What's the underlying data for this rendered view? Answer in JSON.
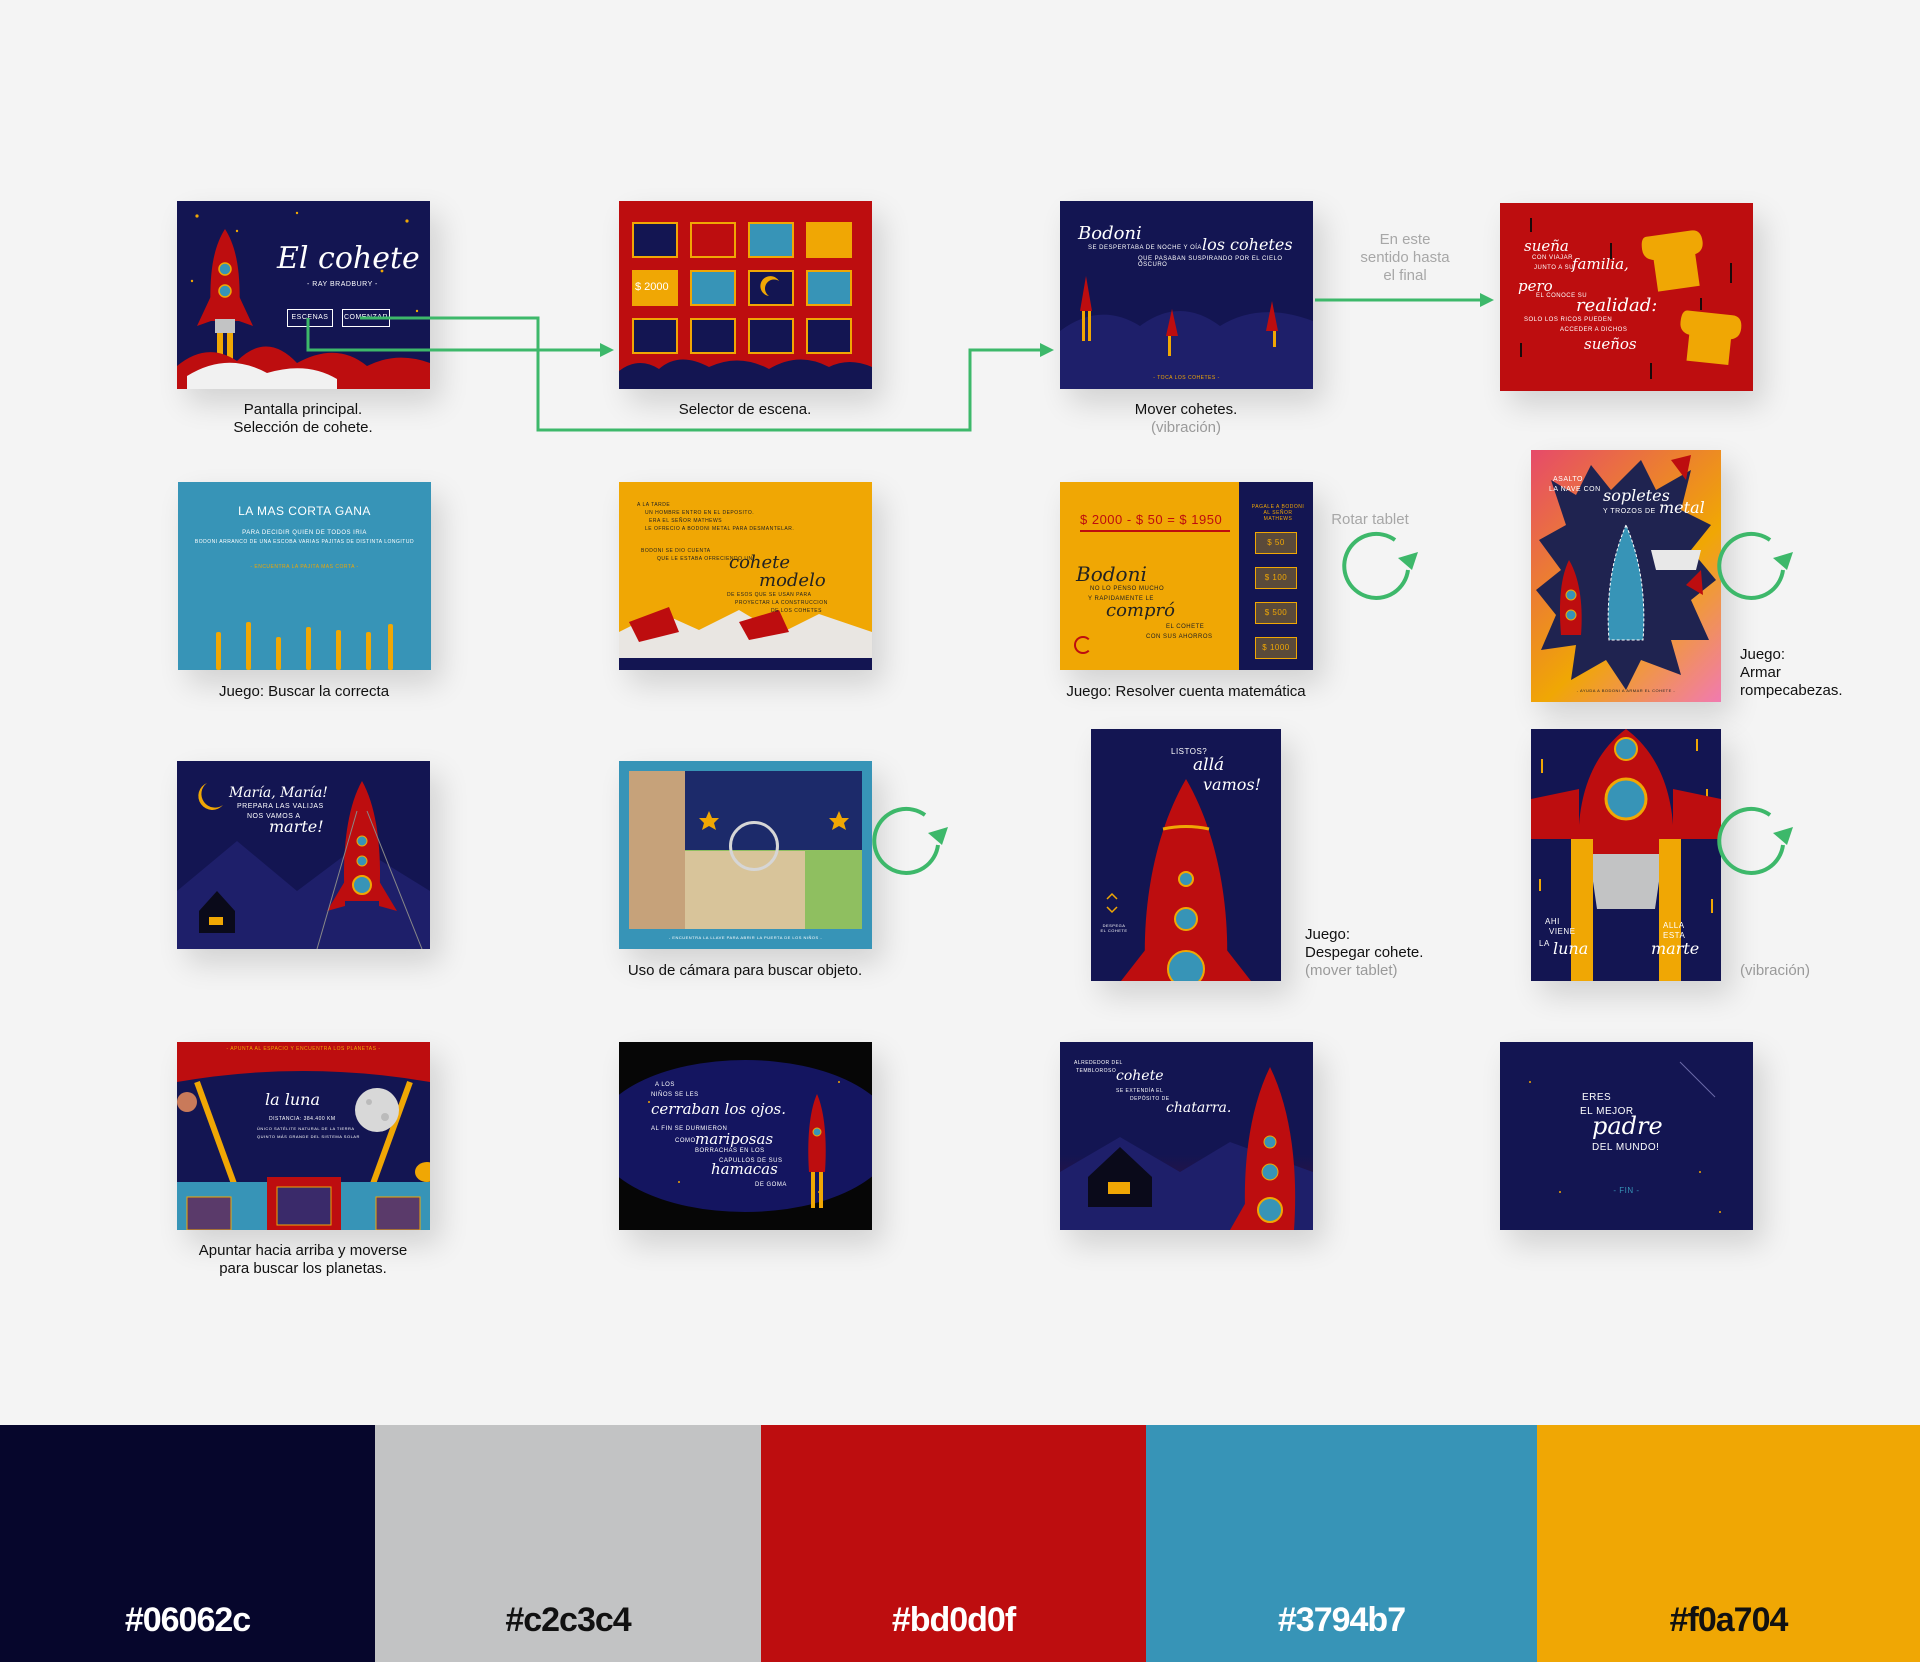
{
  "screens": {
    "s1": {
      "title": "El cohete",
      "author": "- RAY BRADBURY -",
      "btn_escenas": "ESCENAS",
      "btn_comenzar": "COMENZAR",
      "caption": "Pantalla principal.\nSelección de cohete."
    },
    "s2": {
      "price": "$ 2000",
      "caption": "Selector de escena."
    },
    "s3": {
      "name": "Bodoni",
      "line1": "SE DESPERTABA DE NOCHE Y OÍA",
      "script": "los cohetes",
      "line2": "QUE PASABAN SUSPIRANDO POR EL CIELO OSCURO",
      "footer": "- TOCA LOS COHETES -",
      "caption": "Mover cohetes.",
      "caption_sub": "(vibración)"
    },
    "s4": {
      "w1": "sueña",
      "w2": "CON VIAJAR",
      "w3": "JUNTO A SU",
      "w4": "familia,",
      "w5": "pero",
      "w6": "EL CONOCE SU",
      "w7": "realidad:",
      "w8": "SOLO LOS RICOS PUEDEN",
      "w9": "ACCEDER A DICHOS",
      "w10": "sueños"
    },
    "s5": {
      "title": "LA MAS CORTA GANA",
      "line1": "PARA DECIDIR QUIEN DE TODOS IRIA",
      "line2": "BODONI ARRANCO DE UNA ESCOBA VARIAS PAJITAS DE DISTINTA LONGITUD",
      "hint": "- ENCUENTRA LA PAJITA MAS CORTA -",
      "caption": "Juego: Buscar la correcta"
    },
    "s6": {
      "l1": "A LA TARDE",
      "l2": "UN HOMBRE ENTRO EN EL DEPOSITO.",
      "l3": "ERA EL SEÑOR MATHEWS",
      "l4": "LE OFRECIO A BODONI METAL PARA DESMANTELAR.",
      "l5": "BODONI SE DIO CUENTA",
      "l6": "QUE LE ESTABA OFRECIENDO UN",
      "s1": "cohete",
      "s2": "modelo",
      "l7": "DE ESOS QUE SE USAN PARA",
      "l8": "PROYECTAR LA CONSTRUCCION",
      "l9": "DE LOS COHETES"
    },
    "s7": {
      "equation": "$ 2000 - $ 50 = $ 1950",
      "side": "PAGALE A BODONI AL SEÑOR MATHEWS",
      "name": "Bodoni",
      "l1": "NO LO PENSO MUCHO",
      "l2": "Y RAPIDAMENTE LE",
      "s1": "compró",
      "l3": "EL COHETE",
      "l4": "CON SUS AHORROS",
      "coins": [
        "$ 50",
        "$ 100",
        "$ 500",
        "$ 1000"
      ],
      "caption": "Juego: Resolver cuenta matemática"
    },
    "s8": {
      "l1": "ASALTO",
      "l2": "LA NAVE CON",
      "s1": "sopletes",
      "l3": "Y TROZOS DE",
      "s2": "metal",
      "footer": "- AYUDA A BODONI A ARMAR EL COHETE -"
    },
    "s9": {
      "s1": "María, María!",
      "l1": "PREPARA LAS VALIJAS",
      "l2": "NOS VAMOS A",
      "s2": "marte!"
    },
    "s10": {
      "footer": "- ENCUENTRA LA LLAVE PARA ABRIR LA PUERTA DE LOS NIÑOS -",
      "caption": "Uso de cámara para buscar objeto."
    },
    "s11": {
      "l1": "LISTOS?",
      "s1": "allá",
      "s2": "vamos!",
      "side": "DESPEGA EL COHETE",
      "caption": "Juego:\nDespegar cohete.",
      "caption_sub": "(mover tablet)"
    },
    "s12": {
      "l1": "AHI",
      "l2": "VIENE",
      "l3": "LA",
      "s1": "luna",
      "l4": "ALLA",
      "l5": "ESTA",
      "s2": "marte",
      "caption_sub": "(vibración)"
    },
    "s13": {
      "top": "- APUNTA AL ESPACIO Y ENCUENTRA LOS PLANETAS -",
      "title": "la luna",
      "l1": "DISTANCIA: 384.400 KM",
      "l2": "ÚNICO SATÉLITE NATURAL DE LA TIERRA",
      "l3": "QUINTO MÁS GRANDE DEL SISTEMA SOLAR",
      "caption": "Apuntar hacia arriba y moverse\npara buscar los planetas."
    },
    "s14": {
      "l1": "A LOS",
      "l2": "NIÑOS SE LES",
      "s1": "cerraban los ojos.",
      "l3": "AL FIN SE DURMIERON",
      "l4": "COMO",
      "s2": "mariposas",
      "l5": "BORRACHAS EN LOS",
      "l6": "CAPULLOS DE SUS",
      "s3": "hamacas",
      "l7": "DE GOMA"
    },
    "s15": {
      "l1": "ALREDEDOR DEL",
      "l2": "TEMBLOROSO",
      "s1": "cohete",
      "l3": "SE EXTENDÍA EL",
      "l4": "DEPÓSITO DE",
      "s2": "chatarra."
    },
    "s16": {
      "l1": "ERES",
      "l2": "EL MEJOR",
      "s1": "padre",
      "l3": "DEL MUNDO!",
      "fin": "- FIN -"
    }
  },
  "annotations": {
    "direction": "En este\nsentido hasta\nel final",
    "rotate": "Rotar tablet",
    "puzzle": "Juego:\nArmar\nrompecabezas."
  },
  "palette": [
    {
      "hex": "#06062c",
      "label": "#06062c",
      "text_color": "#ffffff"
    },
    {
      "hex": "#c2c3c4",
      "label": "#c2c3c4",
      "text_color": "#111111"
    },
    {
      "hex": "#bd0d0f",
      "label": "#bd0d0f",
      "text_color": "#ffffff"
    },
    {
      "hex": "#3794b7",
      "label": "#3794b7",
      "text_color": "#ffffff"
    },
    {
      "hex": "#f0a704",
      "label": "#f0a704",
      "text_color": "#111111"
    }
  ],
  "colors": {
    "navy": "#131552",
    "red": "#bd0d0f",
    "yellow": "#f0a704",
    "blue": "#3794b7",
    "green": "#3db86a"
  }
}
